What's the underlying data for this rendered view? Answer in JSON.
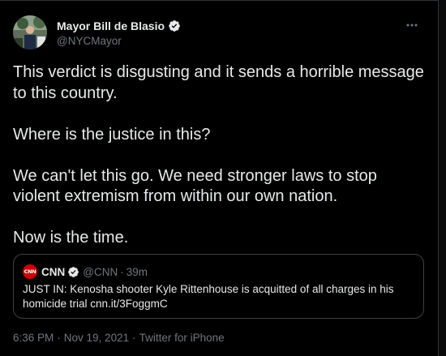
{
  "author": {
    "display_name": "Mayor Bill de Blasio",
    "handle": "@NYCMayor",
    "verified": true
  },
  "tweet": {
    "text": "This verdict is disgusting and it sends a horrible message to this country.\n\nWhere is the justice in this?\n\nWe can't let this go. We need stronger laws to stop violent extremism from within our own nation.\n\nNow is the time."
  },
  "quoted_tweet": {
    "logo_text": "CNN",
    "display_name": "CNN",
    "handle": "@CNN",
    "separator": "·",
    "time": "39m",
    "text": "JUST IN: Kenosha shooter Kyle Rittenhouse is acquitted of all charges in his homicide trial cnn.it/3FoggmC"
  },
  "meta": {
    "time": "6:36 PM",
    "dot1": "·",
    "date": "Nov 19, 2021",
    "dot2": "·",
    "source": "Twitter for iPhone"
  },
  "icons": {
    "verified": "verified-badge-icon",
    "more": "more-horizontal-icon"
  },
  "colors": {
    "background": "#000000",
    "text_primary": "#e7e9ea",
    "text_secondary": "#71767b",
    "border": "#2f3336",
    "cnn_red": "#cc0000"
  }
}
